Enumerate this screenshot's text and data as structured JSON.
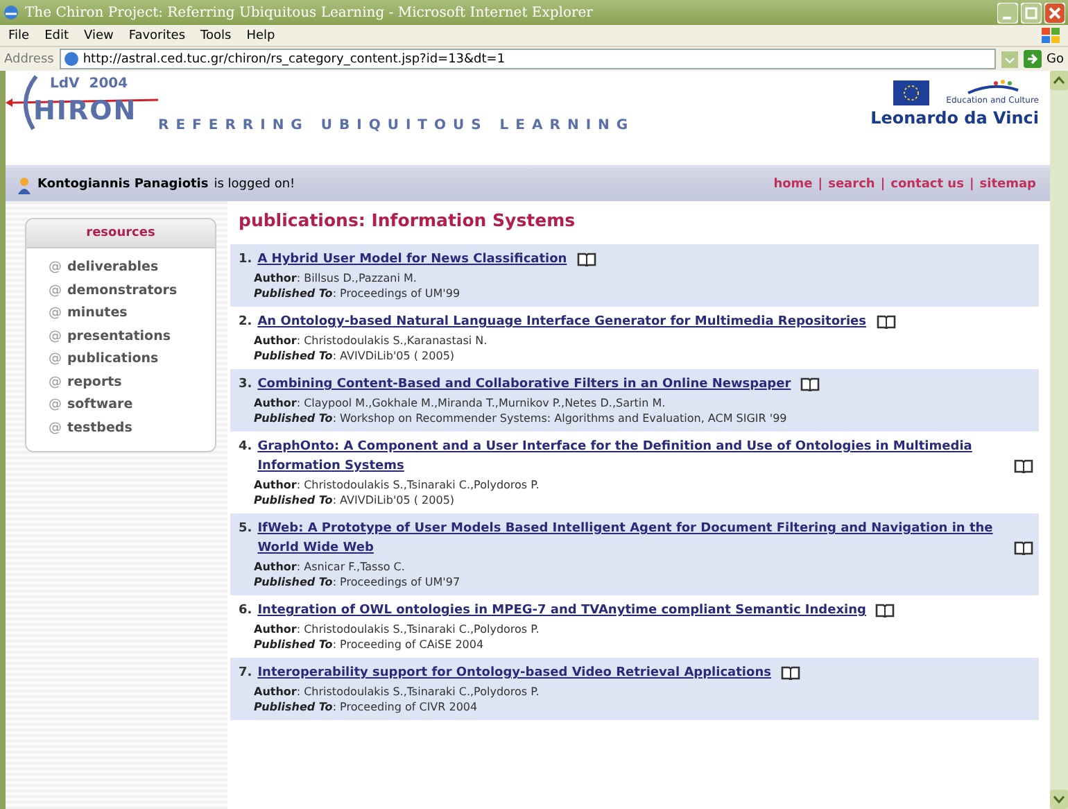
{
  "window": {
    "title": "The Chiron Project: Referring Ubiquitous Learning - Microsoft Internet Explorer"
  },
  "menu": [
    "File",
    "Edit",
    "View",
    "Favorites",
    "Tools",
    "Help"
  ],
  "address": {
    "label": "Address",
    "value": "http://astral.ced.tuc.gr/chiron/rs_category_content.jsp?id=13&dt=1",
    "go": "Go"
  },
  "header": {
    "year": "LdV  2004",
    "logo": "HIRON",
    "tagline": "REFERRING UBIQUITOUS LEARNING",
    "eu_caption": "Education and Culture",
    "program": "Leonardo da Vinci"
  },
  "user_bar": {
    "user": "Kontogiannis Panagiotis",
    "status": "is logged on!",
    "nav": [
      "home",
      "search",
      "contact us",
      "sitemap"
    ],
    "separators": [
      "|",
      "|",
      "|"
    ]
  },
  "sidebar": {
    "title": "resources",
    "items": [
      "deliverables",
      "demonstrators",
      "minutes",
      "presentations",
      "publications",
      "reports",
      "software",
      "testbeds"
    ],
    "bullet": "@"
  },
  "page_title": "publications: Information Systems",
  "publications": [
    {
      "number": "1.",
      "title": "A Hybrid User Model for News Classification",
      "author": "**Author**: Billsus D.,Pazzani M.",
      "published": "**Published To**: Proceedings of UM'99"
    },
    {
      "number": "2.",
      "title": "An Ontology-based Natural Language Interface Generator for Multimedia Repositories",
      "author": "**Author**: Christodoulakis S.,Karanastasi N.",
      "published": "**Published To**: AVIVDiLib'05 ( 2005)"
    },
    {
      "number": "3.",
      "title": "Combining Content-Based and Collaborative Filters in an Online Newspaper",
      "author": "**Author**: Claypool M.,Gokhale M.,Miranda T.,Murnikov P.,Netes D.,Sartin M.",
      "published": "**Published To**: Workshop on Recommender Systems: Algorithms and Evaluation, ACM SIGIR '99"
    },
    {
      "number": "4.",
      "title": "GraphOnto: A Component and a User Interface for the Definition and Use of Ontologies in Multimedia Information Systems",
      "author": "**Author**: Christodoulakis S.,Tsinaraki C.,Polydoros P.",
      "published": "**Published To**: AVIVDiLib'05 ( 2005)"
    },
    {
      "number": "5.",
      "title": "IfWeb: A Prototype of User Models Based Intelligent Agent for Document Filtering and Navigation in the World Wide Web",
      "author": "**Author**: Asnicar F.,Tasso C.",
      "published": "**Published To**: Proceedings of UM'97"
    },
    {
      "number": "6.",
      "title": "Integration of OWL ontologies in MPEG-7 and TVAnytime compliant Semantic Indexing",
      "author": "**Author**: Christodoulakis S.,Tsinaraki C.,Polydoros P.",
      "published": "**Published To**: Proceeding of CAiSE 2004"
    },
    {
      "number": "7.",
      "title": "Interoperability support for Ontology-based Video Retrieval Applications",
      "author": "**Author**: Christodoulakis S.,Tsinaraki C.,Polydoros P.",
      "published": "**Published To**: Proceeding of CIVR 2004"
    }
  ]
}
